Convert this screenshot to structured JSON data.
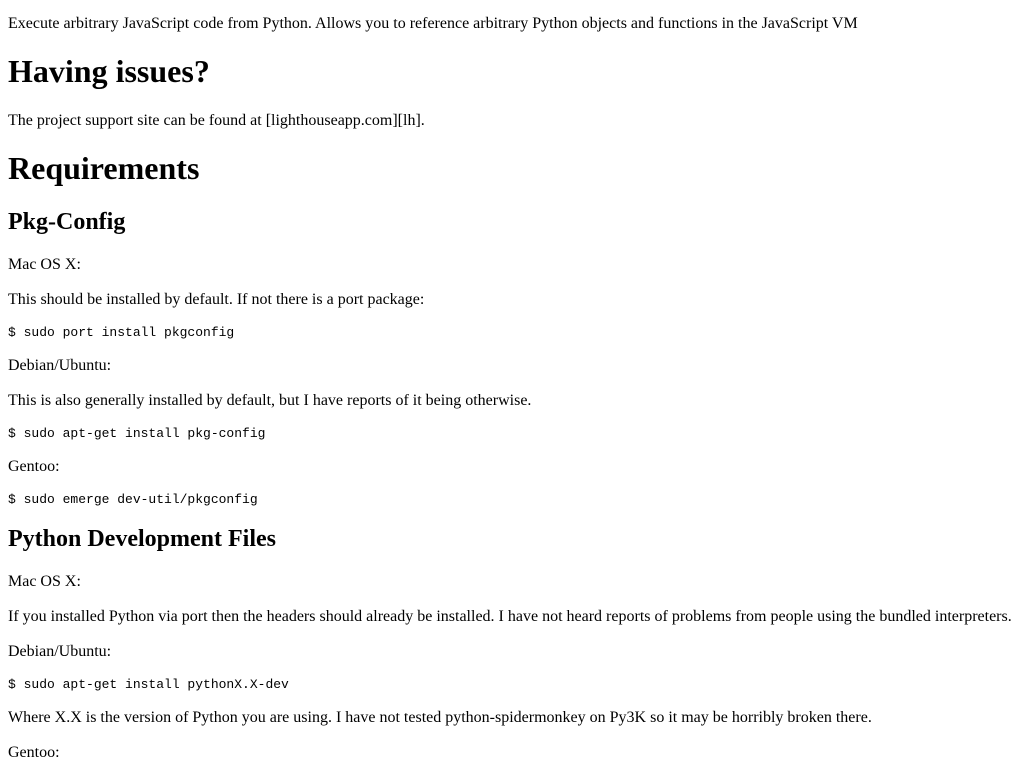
{
  "intro": "Execute arbitrary JavaScript code from Python. Allows you to reference arbitrary Python objects and functions in the JavaScript VM",
  "issues": {
    "heading": "Having issues?",
    "text": "The project support site can be found at [lighthouseapp.com][lh]."
  },
  "requirements": {
    "heading": "Requirements",
    "pkg_config": {
      "heading": "Pkg-Config",
      "mac_label": "Mac OS X:",
      "mac_text": "This should be installed by default. If not there is a port package:",
      "mac_cmd": "$ sudo port install pkgconfig",
      "debian_label": "Debian/Ubuntu:",
      "debian_text": "This is also generally installed by default, but I have reports of it being otherwise.",
      "debian_cmd": "$ sudo apt-get install pkg-config",
      "gentoo_label": "Gentoo:",
      "gentoo_cmd": "$ sudo emerge dev-util/pkgconfig"
    },
    "python_dev": {
      "heading": "Python Development Files",
      "mac_label": "Mac OS X:",
      "mac_text": "If you installed Python via port then the headers should already be installed. I have not heard reports of problems from people using the bundled interpreters.",
      "debian_label": "Debian/Ubuntu:",
      "debian_cmd": "$ sudo apt-get install pythonX.X-dev",
      "version_note": "Where X.X is the version of Python you are using. I have not tested python-spidermonkey on Py3K so it may be horribly broken there.",
      "gentoo_label": "Gentoo:"
    }
  }
}
